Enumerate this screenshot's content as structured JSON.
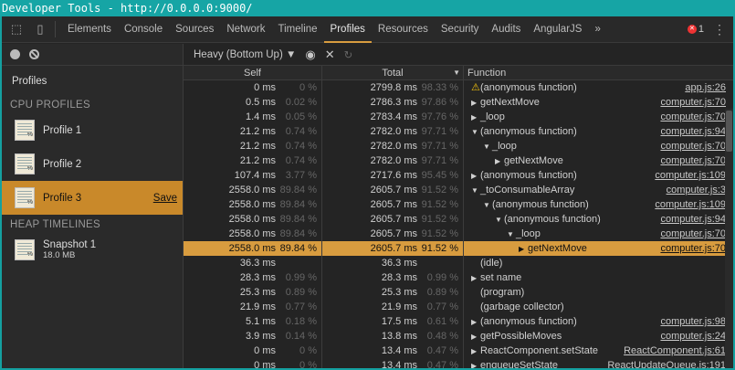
{
  "window_title": "Developer Tools - http://0.0.0.0:9000/",
  "tabs": [
    "Elements",
    "Console",
    "Sources",
    "Network",
    "Timeline",
    "Profiles",
    "Resources",
    "Security",
    "Audits",
    "AngularJS"
  ],
  "active_tab": "Profiles",
  "error_count": "1",
  "sidebar": {
    "title": "Profiles",
    "cpu_header": "CPU PROFILES",
    "heap_header": "HEAP TIMELINES",
    "profiles": [
      "Profile 1",
      "Profile 2",
      "Profile 3"
    ],
    "selected": "Profile 3",
    "save_label": "Save",
    "snapshot": {
      "name": "Snapshot 1",
      "size": "18.0 MB"
    }
  },
  "toolbar": {
    "view_mode": "Heavy (Bottom Up)"
  },
  "headers": {
    "self": "Self",
    "total": "Total",
    "function": "Function"
  },
  "colors": {
    "accent": "#d89c3f",
    "titlebar": "#16a5a5"
  },
  "rows": [
    {
      "self": "0 ms",
      "self_pct": "0 %",
      "total": "2799.8 ms",
      "total_pct": "98.33 %",
      "indent": 0,
      "arrow": "warning",
      "fn": "(anonymous function)",
      "url": "app.js:26"
    },
    {
      "self": "0.5 ms",
      "self_pct": "0.02 %",
      "total": "2786.3 ms",
      "total_pct": "97.86 %",
      "indent": 0,
      "arrow": "right",
      "fn": "getNextMove",
      "url": "computer.js:70"
    },
    {
      "self": "1.4 ms",
      "self_pct": "0.05 %",
      "total": "2783.4 ms",
      "total_pct": "97.76 %",
      "indent": 0,
      "arrow": "right",
      "fn": "_loop",
      "url": "computer.js:70"
    },
    {
      "self": "21.2 ms",
      "self_pct": "0.74 %",
      "total": "2782.0 ms",
      "total_pct": "97.71 %",
      "indent": 0,
      "arrow": "down",
      "fn": "(anonymous function)",
      "url": "computer.js:94"
    },
    {
      "self": "21.2 ms",
      "self_pct": "0.74 %",
      "total": "2782.0 ms",
      "total_pct": "97.71 %",
      "indent": 1,
      "arrow": "down",
      "fn": "_loop",
      "url": "computer.js:70"
    },
    {
      "self": "21.2 ms",
      "self_pct": "0.74 %",
      "total": "2782.0 ms",
      "total_pct": "97.71 %",
      "indent": 2,
      "arrow": "right",
      "fn": "getNextMove",
      "url": "computer.js:70"
    },
    {
      "self": "107.4 ms",
      "self_pct": "3.77 %",
      "total": "2717.6 ms",
      "total_pct": "95.45 %",
      "indent": 0,
      "arrow": "right",
      "fn": "(anonymous function)",
      "url": "computer.js:109"
    },
    {
      "self": "2558.0 ms",
      "self_pct": "89.84 %",
      "total": "2605.7 ms",
      "total_pct": "91.52 %",
      "indent": 0,
      "arrow": "down",
      "fn": "_toConsumableArray",
      "url": "computer.js:3"
    },
    {
      "self": "2558.0 ms",
      "self_pct": "89.84 %",
      "total": "2605.7 ms",
      "total_pct": "91.52 %",
      "indent": 1,
      "arrow": "down",
      "fn": "(anonymous function)",
      "url": "computer.js:109"
    },
    {
      "self": "2558.0 ms",
      "self_pct": "89.84 %",
      "total": "2605.7 ms",
      "total_pct": "91.52 %",
      "indent": 2,
      "arrow": "down",
      "fn": "(anonymous function)",
      "url": "computer.js:94"
    },
    {
      "self": "2558.0 ms",
      "self_pct": "89.84 %",
      "total": "2605.7 ms",
      "total_pct": "91.52 %",
      "indent": 3,
      "arrow": "down",
      "fn": "_loop",
      "url": "computer.js:70"
    },
    {
      "self": "2558.0 ms",
      "self_pct": "89.84 %",
      "total": "2605.7 ms",
      "total_pct": "91.52 %",
      "indent": 4,
      "arrow": "right",
      "fn": "getNextMove",
      "url": "computer.js:70",
      "selected": true
    },
    {
      "self": "36.3 ms",
      "self_pct": "",
      "total": "36.3 ms",
      "total_pct": "",
      "indent": 0,
      "arrow": "none",
      "fn": "(idle)",
      "url": ""
    },
    {
      "self": "28.3 ms",
      "self_pct": "0.99 %",
      "total": "28.3 ms",
      "total_pct": "0.99 %",
      "indent": 0,
      "arrow": "right",
      "fn": "set name",
      "url": ""
    },
    {
      "self": "25.3 ms",
      "self_pct": "0.89 %",
      "total": "25.3 ms",
      "total_pct": "0.89 %",
      "indent": 0,
      "arrow": "none",
      "fn": "(program)",
      "url": ""
    },
    {
      "self": "21.9 ms",
      "self_pct": "0.77 %",
      "total": "21.9 ms",
      "total_pct": "0.77 %",
      "indent": 0,
      "arrow": "none",
      "fn": "(garbage collector)",
      "url": ""
    },
    {
      "self": "5.1 ms",
      "self_pct": "0.18 %",
      "total": "17.5 ms",
      "total_pct": "0.61 %",
      "indent": 0,
      "arrow": "right",
      "fn": "(anonymous function)",
      "url": "computer.js:98"
    },
    {
      "self": "3.9 ms",
      "self_pct": "0.14 %",
      "total": "13.8 ms",
      "total_pct": "0.48 %",
      "indent": 0,
      "arrow": "right",
      "fn": "getPossibleMoves",
      "url": "computer.js:24"
    },
    {
      "self": "0 ms",
      "self_pct": "0 %",
      "total": "13.4 ms",
      "total_pct": "0.47 %",
      "indent": 0,
      "arrow": "right",
      "fn": "ReactComponent.setState",
      "url": "ReactComponent.js:61"
    },
    {
      "self": "0 ms",
      "self_pct": "0 %",
      "total": "13.4 ms",
      "total_pct": "0.47 %",
      "indent": 0,
      "arrow": "right",
      "fn": "enqueueSetState",
      "url": "ReactUpdateQueue.js:191"
    }
  ]
}
